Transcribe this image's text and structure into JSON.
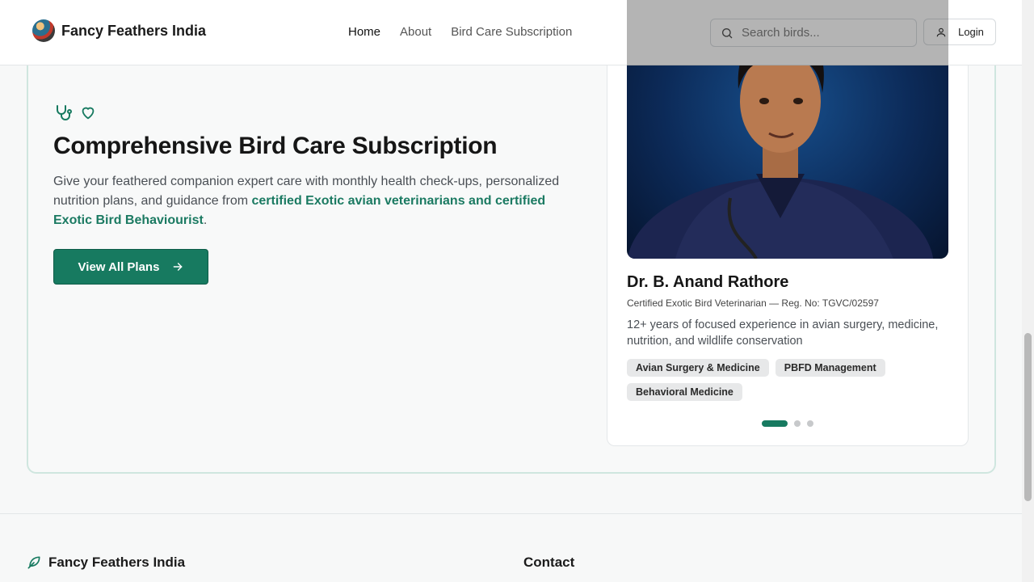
{
  "header": {
    "brand": "Fancy Feathers India",
    "nav": [
      "Home",
      "About",
      "Bird Care Subscription"
    ],
    "search_placeholder": "Search birds...",
    "login_label": "Login"
  },
  "hero": {
    "title": "Comprehensive Bird Care Subscription",
    "desc_prefix": "Give your feathered companion expert care with monthly health check-ups, personalized nutrition plans, and guidance from ",
    "desc_highlight": "certified Exotic avian veterinarians and certified Exotic Bird Behaviourist",
    "desc_suffix": ".",
    "cta_label": "View All Plans"
  },
  "vet": {
    "name": "Dr. B. Anand Rathore",
    "reg": "Certified Exotic Bird Veterinarian — Reg. No: TGVC/02597",
    "experience": "12+ years of focused experience in avian surgery, medicine, nutrition, and wildlife conservation",
    "tags": [
      "Avian Surgery & Medicine",
      "PBFD Management",
      "Behavioral Medicine"
    ],
    "carousel_active": 1,
    "carousel_total": 3
  },
  "footer": {
    "brand": "Fancy Feathers India",
    "contact_heading": "Contact"
  },
  "colors": {
    "accent": "#177a60",
    "highlight_text": "#1b7a62"
  }
}
